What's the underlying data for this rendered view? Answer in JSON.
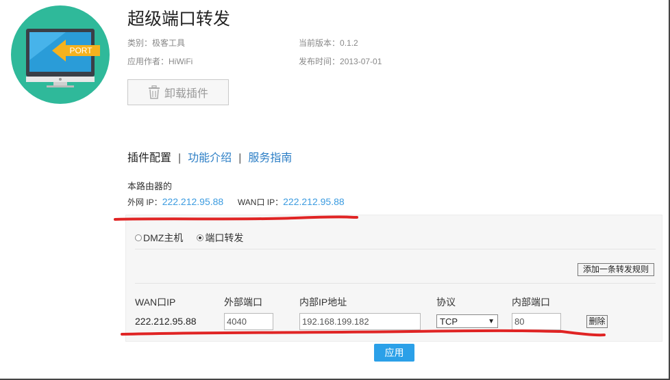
{
  "plugin": {
    "title": "超级端口转发",
    "category_label": "类别：",
    "category": "极客工具",
    "author_label": "应用作者：",
    "author": "HiWiFi",
    "version_label": "当前版本：",
    "version": "0.1.2",
    "release_label": "发布时间：",
    "release_date": "2013-07-01",
    "uninstall_label": "卸载插件",
    "logo_badge": "PORT"
  },
  "tabs": {
    "config": "插件配置",
    "intro": "功能介绍",
    "guide": "服务指南",
    "separator": "|"
  },
  "router": {
    "label": "本路由器的",
    "external_ip_label": "外网 IP：",
    "external_ip": "222.212.95.88",
    "wan_ip_label": "WAN口 IP：",
    "wan_ip": "222.212.95.88"
  },
  "mode": {
    "dmz_label": "DMZ主机",
    "port_forward_label": "端口转发",
    "selected": "端口转发"
  },
  "rules": {
    "add_label": "添加一条转发规则",
    "columns": {
      "wan_ip": "WAN口IP",
      "external_port": "外部端口",
      "internal_ip": "内部IP地址",
      "protocol": "协议",
      "internal_port": "内部端口"
    },
    "rows": [
      {
        "wan_ip": "222.212.95.88",
        "external_port": "4040",
        "internal_ip": "192.168.199.182",
        "protocol": "TCP",
        "internal_port": "80",
        "delete_label": "删除"
      }
    ]
  },
  "apply_label": "应用",
  "colors": {
    "logo_bg": "#2fb99a",
    "link": "#2a7dc5",
    "ip_value": "#3b9be0",
    "primary_button": "#2ba0e8",
    "annotation_red": "#e02424"
  },
  "icons": {
    "uninstall": "trash-icon",
    "logo": "monitor-port-icon",
    "select": "dropdown-arrow-icon"
  }
}
